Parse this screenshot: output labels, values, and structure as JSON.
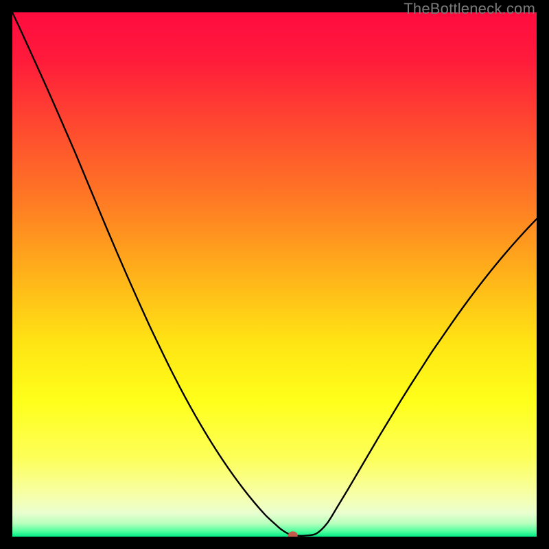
{
  "watermark": "TheBottleneck.com",
  "colors": {
    "curve": "#000000",
    "marker": "#c45a4a",
    "gradient_top": "#ff0b3f",
    "gradient_bottom": "#00e884"
  },
  "chart_data": {
    "type": "line",
    "title": "",
    "xlabel": "",
    "ylabel": "",
    "xlim": [
      0,
      100
    ],
    "ylim": [
      0,
      100
    ],
    "x": [
      0,
      2,
      4,
      6,
      8,
      10,
      12,
      14,
      16,
      18,
      20,
      22,
      24,
      26,
      28,
      30,
      32,
      34,
      36,
      38,
      40,
      42,
      44,
      46,
      48,
      49,
      50,
      51,
      52,
      53,
      54,
      56,
      58,
      60,
      62,
      64,
      66,
      68,
      70,
      72,
      74,
      76,
      78,
      80,
      82,
      84,
      86,
      88,
      90,
      92,
      94,
      96,
      98,
      100
    ],
    "values": [
      100,
      95.7,
      91.3,
      86.9,
      82.4,
      77.8,
      73.2,
      68.4,
      63.6,
      58.8,
      54.1,
      49.5,
      45.0,
      40.6,
      36.4,
      32.3,
      28.4,
      24.7,
      21.2,
      17.9,
      14.8,
      11.9,
      9.2,
      6.7,
      4.4,
      3.4,
      2.5,
      1.6,
      0.9,
      0.4,
      0.2,
      0.2,
      0.6,
      2.5,
      5.7,
      9.0,
      12.4,
      15.8,
      19.2,
      22.5,
      25.8,
      29.0,
      32.1,
      35.2,
      38.1,
      41.0,
      43.8,
      46.5,
      49.1,
      51.6,
      54.0,
      56.3,
      58.5,
      60.6
    ],
    "optimum": {
      "x": 53.5,
      "y": 0.2
    },
    "marker_size": {
      "w": 1.8,
      "h": 1.6
    }
  }
}
